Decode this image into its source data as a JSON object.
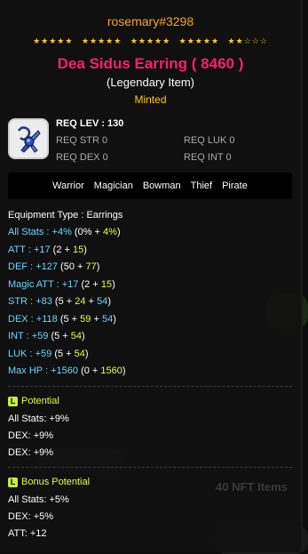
{
  "owner": "rosemary#3298",
  "stars": {
    "filled": 22,
    "total": 25
  },
  "title": "Dea Sidus Earring ( 8460 )",
  "subtitle": "(Legendary Item)",
  "status": "Minted",
  "requirements": {
    "lev": "REQ LEV : 130",
    "str": "REQ STR  0",
    "dex": "REQ DEX  0",
    "luk": "REQ LUK  0",
    "int": "REQ INT  0"
  },
  "jobs": [
    "Warrior",
    "Magician",
    "Bowman",
    "Thief",
    "Pirate"
  ],
  "equipment_type": "Equipment Type :  Earrings",
  "stats": [
    {
      "name": "All Stats :",
      "total": "+4%",
      "base": "0%",
      "bonus1": "4%",
      "bonus2": ""
    },
    {
      "name": "ATT :",
      "total": "+17",
      "base": "2",
      "bonus1": "15",
      "bonus2": ""
    },
    {
      "name": "DEF :",
      "total": "+127",
      "base": "50",
      "bonus1": "77",
      "bonus2": ""
    },
    {
      "name": "Magic ATT :",
      "total": "+17",
      "base": "2",
      "bonus1": "15",
      "bonus2": ""
    },
    {
      "name": "STR :",
      "total": "+83",
      "base": "5",
      "bonus1": "24",
      "bonus2": "54"
    },
    {
      "name": "DEX :",
      "total": "+118",
      "base": "5",
      "bonus1": "59",
      "bonus2": "54"
    },
    {
      "name": "INT :",
      "total": "+59",
      "base": "5",
      "bonus1": "54",
      "bonus2": ""
    },
    {
      "name": "LUK :",
      "total": "+59",
      "base": "5",
      "bonus1": "54",
      "bonus2": ""
    },
    {
      "name": "Max HP :",
      "total": "+1560",
      "base": "0",
      "bonus1": "1560",
      "bonus2": ""
    }
  ],
  "potential": {
    "badge": "L",
    "title": "Potential",
    "lines": [
      "All Stats: +9%",
      "DEX: +9%",
      "DEX: +9%"
    ]
  },
  "bonus_potential": {
    "badge": "L",
    "title": "Bonus Potential",
    "lines": [
      "All Stats: +5%",
      "DEX: +5%",
      "ATT: +12"
    ]
  },
  "background_text": "40 NFT Items",
  "colors": {
    "title": "#ff1f6b",
    "owner": "#f5a623",
    "stat_cyan": "#6ed4ff",
    "bonus_yellow": "#e6ff3c",
    "badge": "#c5ef3c"
  }
}
